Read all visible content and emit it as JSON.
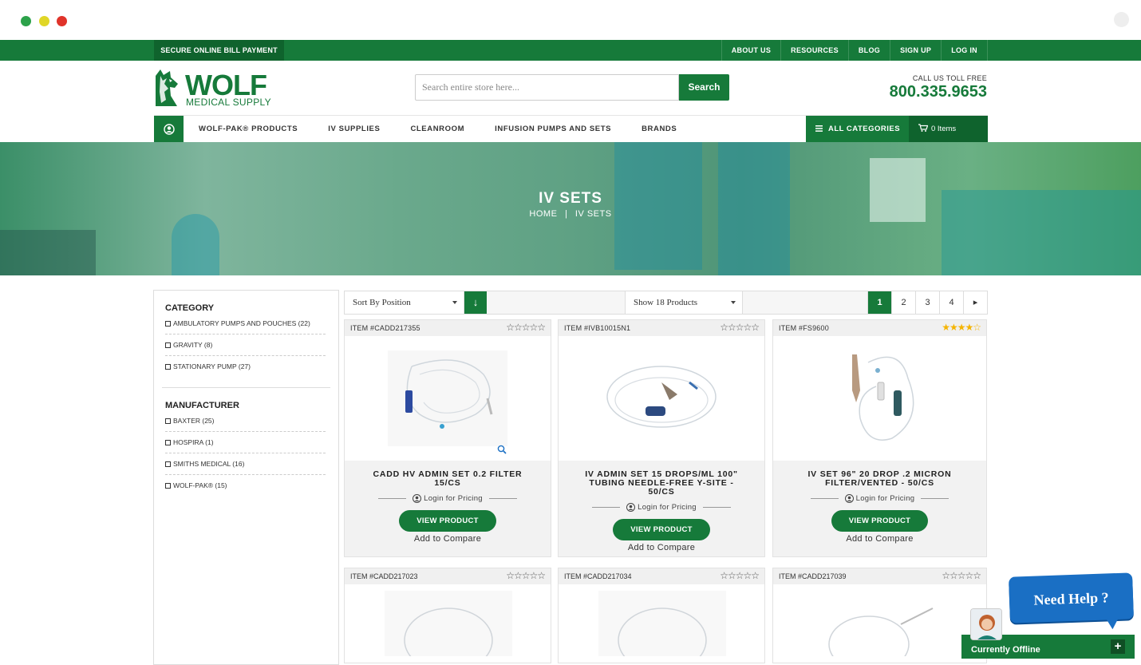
{
  "topbar": {
    "bill_payment": "SECURE ONLINE BILL PAYMENT",
    "links": [
      "ABOUT US",
      "RESOURCES",
      "BLOG",
      "SIGN UP",
      "LOG IN"
    ]
  },
  "header": {
    "logo_main": "WOLF",
    "logo_sub": "MEDICAL SUPPLY",
    "search_placeholder": "Search entire store here...",
    "search_button": "Search",
    "call_label": "CALL US TOLL FREE",
    "phone": "800.335.9653"
  },
  "nav": {
    "items": [
      "WOLF-PAK® PRODUCTS",
      "IV SUPPLIES",
      "CLEANROOM",
      "INFUSION PUMPS AND SETS",
      "BRANDS"
    ],
    "all_categories": "ALL CATEGORIES",
    "cart": "0 Items"
  },
  "hero": {
    "title": "IV SETS",
    "breadcrumb_home": "HOME",
    "breadcrumb_sep": "|",
    "breadcrumb_current": "IV SETS"
  },
  "sidebar": {
    "category_title": "CATEGORY",
    "categories": [
      "AMBULATORY PUMPS AND POUCHES (22)",
      "GRAVITY (8)",
      "STATIONARY PUMP (27)"
    ],
    "manufacturer_title": "MANUFACTURER",
    "manufacturers": [
      "BAXTER (25)",
      "HOSPIRA (1)",
      "SMITHS MEDICAL (16)",
      "WOLF-PAK® (15)"
    ]
  },
  "toolbar": {
    "sort": "Sort By Position",
    "show": "Show 18 Products",
    "pages": [
      "1",
      "2",
      "3",
      "4"
    ],
    "next": "▸"
  },
  "products": [
    {
      "item": "ITEM #CADD217355",
      "name": "CADD HV ADMIN SET 0.2 FILTER 15/CS",
      "rating": 0,
      "login": "Login for Pricing",
      "button": "VIEW PRODUCT",
      "compare": "Add to Compare"
    },
    {
      "item": "ITEM #IVB10015N1",
      "name": "IV ADMIN SET 15 DROPS/ML 100\" TUBING NEEDLE-FREE Y-SITE - 50/CS",
      "rating": 0,
      "login": "Login for Pricing",
      "button": "VIEW PRODUCT",
      "compare": "Add to Compare"
    },
    {
      "item": "ITEM #FS9600",
      "name": "IV SET 96\" 20 DROP .2 MICRON FILTER/VENTED - 50/CS",
      "rating": 4,
      "login": "Login for Pricing",
      "button": "VIEW PRODUCT",
      "compare": "Add to Compare"
    },
    {
      "item": "ITEM #CADD217023",
      "rating": 0
    },
    {
      "item": "ITEM #CADD217034",
      "rating": 0
    },
    {
      "item": "ITEM #CADD217039",
      "rating": 0
    }
  ],
  "chat": {
    "need_help": "Need Help ?",
    "status": "Currently Offline",
    "toggle": "+"
  },
  "colors": {
    "brand_green": "#167a3a",
    "dark_green": "#0f632d",
    "star_gold": "#f5b400",
    "chat_blue": "#1a6fc4"
  }
}
